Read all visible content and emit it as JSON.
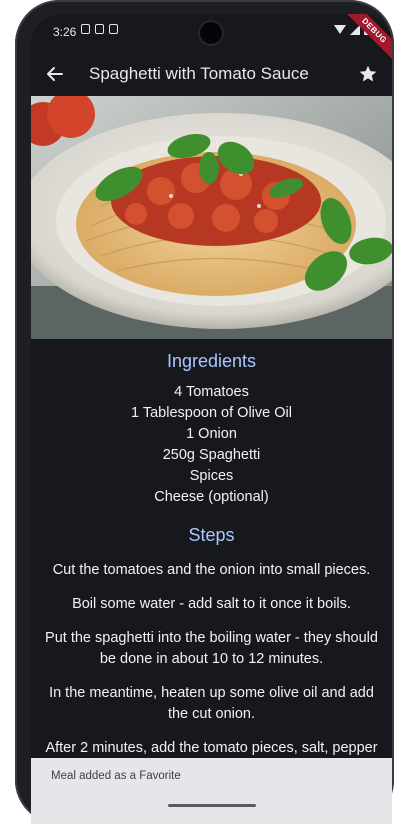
{
  "status": {
    "time": "3:26"
  },
  "debug_banner": "DEBUG",
  "app_bar": {
    "title": "Spaghetti with Tomato Sauce"
  },
  "ingredients": {
    "title": "Ingredients",
    "items": [
      "4 Tomatoes",
      "1 Tablespoon of Olive Oil",
      "1 Onion",
      "250g Spaghetti",
      "Spices",
      "Cheese (optional)"
    ]
  },
  "steps": {
    "title": "Steps",
    "items": [
      "Cut the tomatoes and the onion into small pieces.",
      "Boil some water - add salt to it once it boils.",
      "Put the spaghetti into the boiling water - they should be done in about 10 to 12 minutes.",
      "In the meantime, heaten up some olive oil and add the cut onion.",
      "After 2 minutes, add the tomato pieces, salt, pepper"
    ]
  },
  "snackbar": {
    "message": "Meal added as a Favorite"
  },
  "colors": {
    "accent": "#a9c7ff",
    "background": "#17181d",
    "debug": "#a11a2b"
  },
  "icons": {
    "back": "arrow-left-icon",
    "favorite": "star-icon"
  }
}
